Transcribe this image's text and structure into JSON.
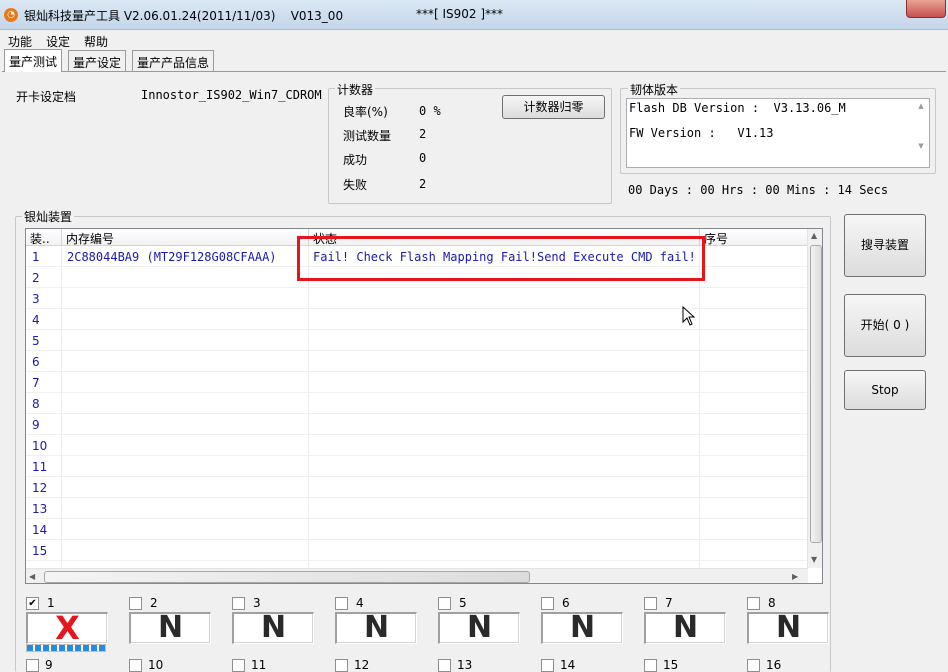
{
  "window": {
    "icon": "app-logo-icon",
    "title": "银灿科技量产工具 V2.06.01.24(2011/11/03)    V013_00",
    "center_title": "***[ IS902 ]***"
  },
  "menu": [
    "功能",
    "设定",
    "帮助"
  ],
  "tabs": [
    "量产测试",
    "量产设定",
    "量产产品信息"
  ],
  "config": {
    "label": "开卡设定档",
    "value": "Innostor_IS902_Win7_CDROM"
  },
  "counter": {
    "title": "计数器",
    "rows": [
      {
        "label": "良率(%)",
        "value": "0 %"
      },
      {
        "label": "测试数量",
        "value": "2"
      },
      {
        "label": "成功",
        "value": "0"
      },
      {
        "label": "失败",
        "value": "2"
      }
    ],
    "reset_button": "计数器归零"
  },
  "firmware": {
    "title": "韧体版本",
    "flash_db": "Flash DB Version :  V3.13.06_M",
    "fw": "FW Version :   V1.13",
    "elapsed": "00 Days : 00 Hrs : 00 Mins : 14 Secs"
  },
  "devices": {
    "title": "银灿装置",
    "columns": [
      "装..",
      "内存编号",
      "状态",
      "序号"
    ],
    "rows": [
      {
        "num": "1",
        "memory": "2C88044BA9 (MT29F128G08CFAAA)",
        "status": "Fail! Check Flash Mapping Fail!Send Execute CMD fail!",
        "serial": ""
      },
      {
        "num": "2",
        "memory": "",
        "status": "",
        "serial": ""
      },
      {
        "num": "3",
        "memory": "",
        "status": "",
        "serial": ""
      },
      {
        "num": "4",
        "memory": "",
        "status": "",
        "serial": ""
      },
      {
        "num": "5",
        "memory": "",
        "status": "",
        "serial": ""
      },
      {
        "num": "6",
        "memory": "",
        "status": "",
        "serial": ""
      },
      {
        "num": "7",
        "memory": "",
        "status": "",
        "serial": ""
      },
      {
        "num": "8",
        "memory": "",
        "status": "",
        "serial": ""
      },
      {
        "num": "9",
        "memory": "",
        "status": "",
        "serial": ""
      },
      {
        "num": "10",
        "memory": "",
        "status": "",
        "serial": ""
      },
      {
        "num": "11",
        "memory": "",
        "status": "",
        "serial": ""
      },
      {
        "num": "12",
        "memory": "",
        "status": "",
        "serial": ""
      },
      {
        "num": "13",
        "memory": "",
        "status": "",
        "serial": ""
      },
      {
        "num": "14",
        "memory": "",
        "status": "",
        "serial": ""
      },
      {
        "num": "15",
        "memory": "",
        "status": "",
        "serial": ""
      }
    ]
  },
  "actions": {
    "search": "搜寻装置",
    "start": "开始( 0 )",
    "stop": "Stop"
  },
  "slots_row1": [
    {
      "num": "1",
      "checked": true,
      "state": "X",
      "progress": 1.0
    },
    {
      "num": "2",
      "checked": false,
      "state": "N"
    },
    {
      "num": "3",
      "checked": false,
      "state": "N"
    },
    {
      "num": "4",
      "checked": false,
      "state": "N"
    },
    {
      "num": "5",
      "checked": false,
      "state": "N"
    },
    {
      "num": "6",
      "checked": false,
      "state": "N"
    },
    {
      "num": "7",
      "checked": false,
      "state": "N"
    },
    {
      "num": "8",
      "checked": false,
      "state": "N"
    }
  ],
  "slots_row2": [
    "9",
    "10",
    "11",
    "12",
    "13",
    "14",
    "15",
    "16"
  ],
  "colors": {
    "fail": "#e8141c",
    "text_blue": "#1a1ab0",
    "progress": "#2b8ae0"
  }
}
